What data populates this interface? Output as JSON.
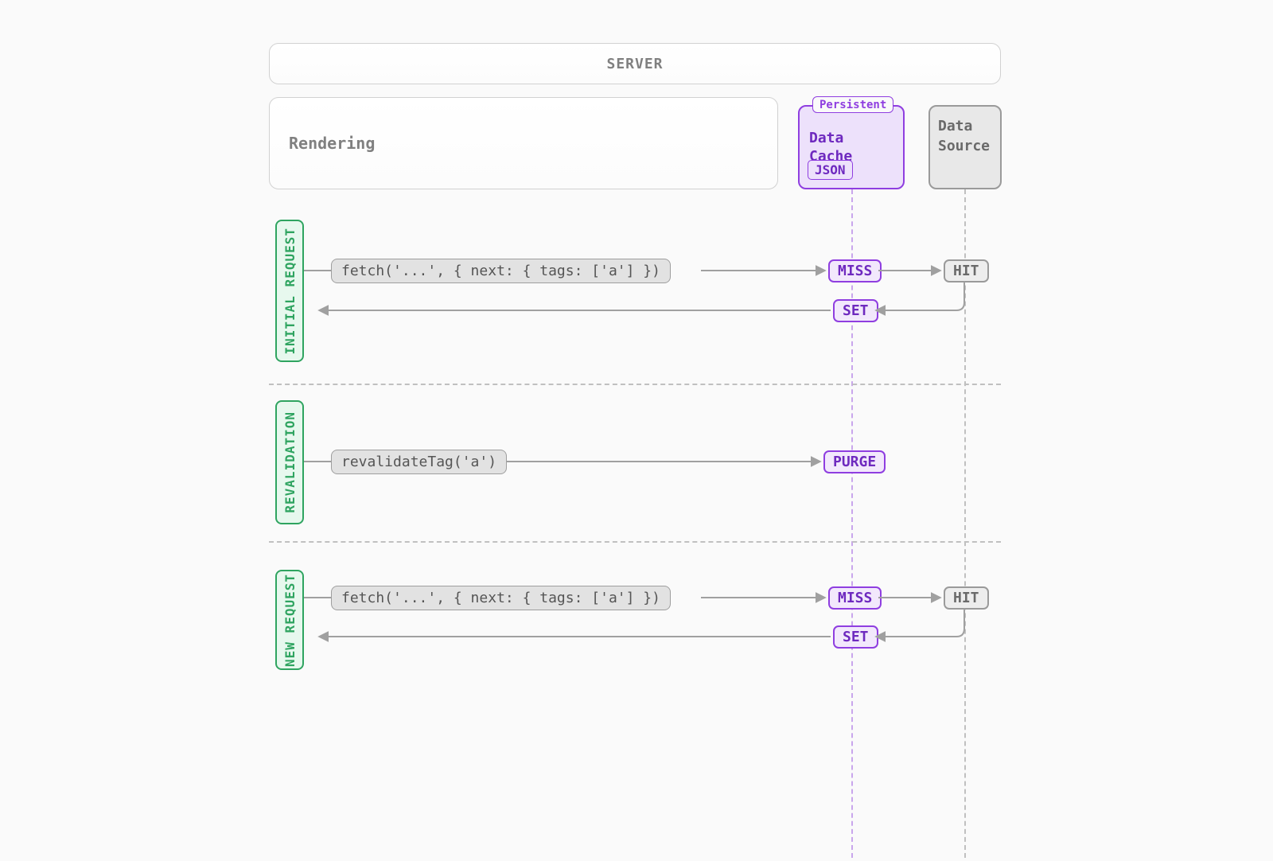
{
  "header": {
    "server": "SERVER"
  },
  "boxes": {
    "rendering": "Rendering",
    "data_cache": {
      "tab": "Persistent",
      "title": "Data Cache",
      "sub": "JSON"
    },
    "data_source": "Data Source"
  },
  "sections": {
    "initial": {
      "label": "INITIAL REQUEST"
    },
    "revalidation": {
      "label": "REVALIDATION"
    },
    "new": {
      "label": "NEW REQUEST"
    }
  },
  "calls": {
    "fetch_initial": "fetch('...', { next: { tags: ['a'] })",
    "revalidate_tag": "revalidateTag('a')",
    "fetch_new": "fetch('...', { next: { tags: ['a'] })"
  },
  "pills": {
    "miss": "MISS",
    "hit": "HIT",
    "set": "SET",
    "purge": "PURGE"
  }
}
